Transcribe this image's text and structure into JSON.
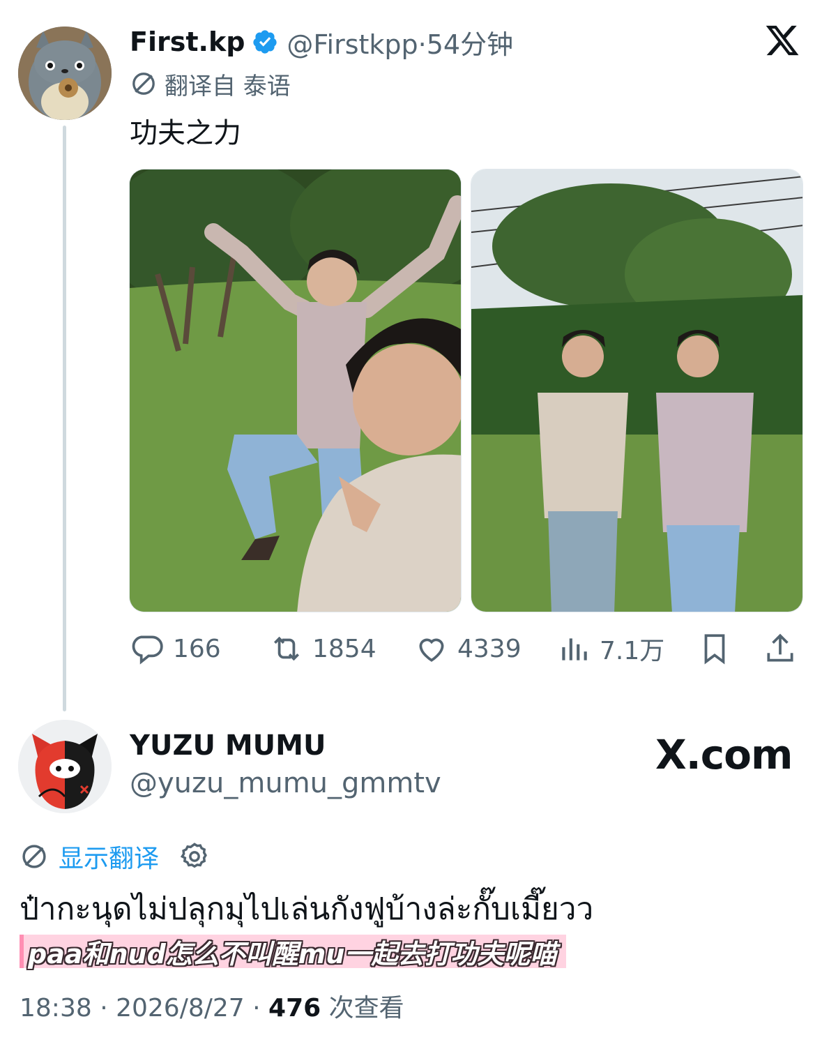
{
  "tweet": {
    "author_name": "First.kp",
    "handle": "@Firstkpp",
    "time": "54分钟",
    "translated_from": "翻译自 泰语",
    "text": "功夫之力",
    "stats": {
      "replies": "166",
      "retweets": "1854",
      "likes": "4339",
      "views": "7.1万"
    }
  },
  "reply": {
    "author_name": "YUZU MUMU",
    "handle": "@yuzu_mumu_gmmtv",
    "watermark": "X.com",
    "show_translation": "显示翻译",
    "text": "ป๋ากะนุดไม่ปลุกมุไปเล่นกังฟูบ้างล่ะกั๊บเมี๊ยวว",
    "subtitle": "paa和nud怎么不叫醒mu一起去打功夫呢喵",
    "time": "18:38",
    "date": "2026/8/27",
    "views_count": "476",
    "views_label": "次查看"
  },
  "colors": {
    "accent": "#1d9bf0",
    "secondary_text": "#536471",
    "subtitle_bg": "#ffd3e1"
  }
}
